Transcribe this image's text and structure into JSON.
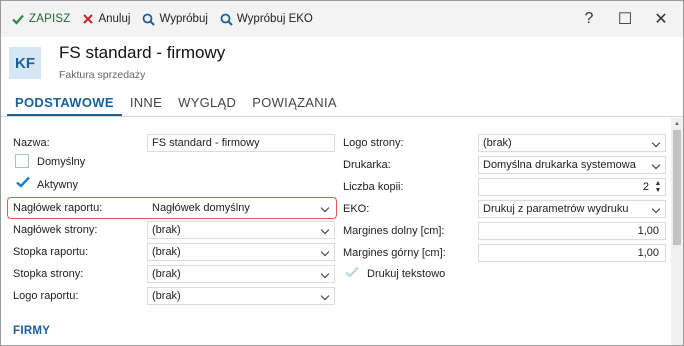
{
  "toolbar": {
    "save": "ZAPISZ",
    "cancel": "Anuluj",
    "try": "Wypróbuj",
    "try_eko": "Wypróbuj EKO",
    "help": "?",
    "maximize": "☐",
    "close": "✕"
  },
  "header": {
    "badge": "KF",
    "title": "FS standard - firmowy",
    "subtitle": "Faktura sprzedaży"
  },
  "tabs": [
    "PODSTAWOWE",
    "INNE",
    "WYGLĄD",
    "POWIĄZANIA"
  ],
  "left": {
    "name_label": "Nazwa:",
    "name_value": "FS standard - firmowy",
    "default_label": "Domyślny",
    "active_label": "Aktywny",
    "report_header_label": "Nagłówek raportu:",
    "report_header_value": "Nagłówek domyślny",
    "page_header_label": "Nagłówek strony:",
    "page_header_value": "(brak)",
    "report_footer_label": "Stopka raportu:",
    "report_footer_value": "(brak)",
    "page_footer_label": "Stopka strony:",
    "page_footer_value": "(brak)",
    "report_logo_label": "Logo raportu:",
    "report_logo_value": "(brak)"
  },
  "right": {
    "page_logo_label": "Logo strony:",
    "page_logo_value": "(brak)",
    "printer_label": "Drukarka:",
    "printer_value": "Domyślna drukarka systemowa",
    "copies_label": "Liczba kopii:",
    "copies_value": "2",
    "eko_label": "EKO:",
    "eko_value": "Drukuj z parametrów wydruku",
    "margin_bottom_label": "Margines dolny [cm]:",
    "margin_bottom_value": "1,00",
    "margin_top_label": "Margines górny [cm]:",
    "margin_top_value": "1,00",
    "print_text_label": "Drukuj tekstowo"
  },
  "section": {
    "firms": "FIRMY"
  },
  "colors": {
    "accent": "#1b5f9c",
    "save_green": "#1e6b2e",
    "cancel_red": "#c62828",
    "highlight": "#e05a5a"
  }
}
